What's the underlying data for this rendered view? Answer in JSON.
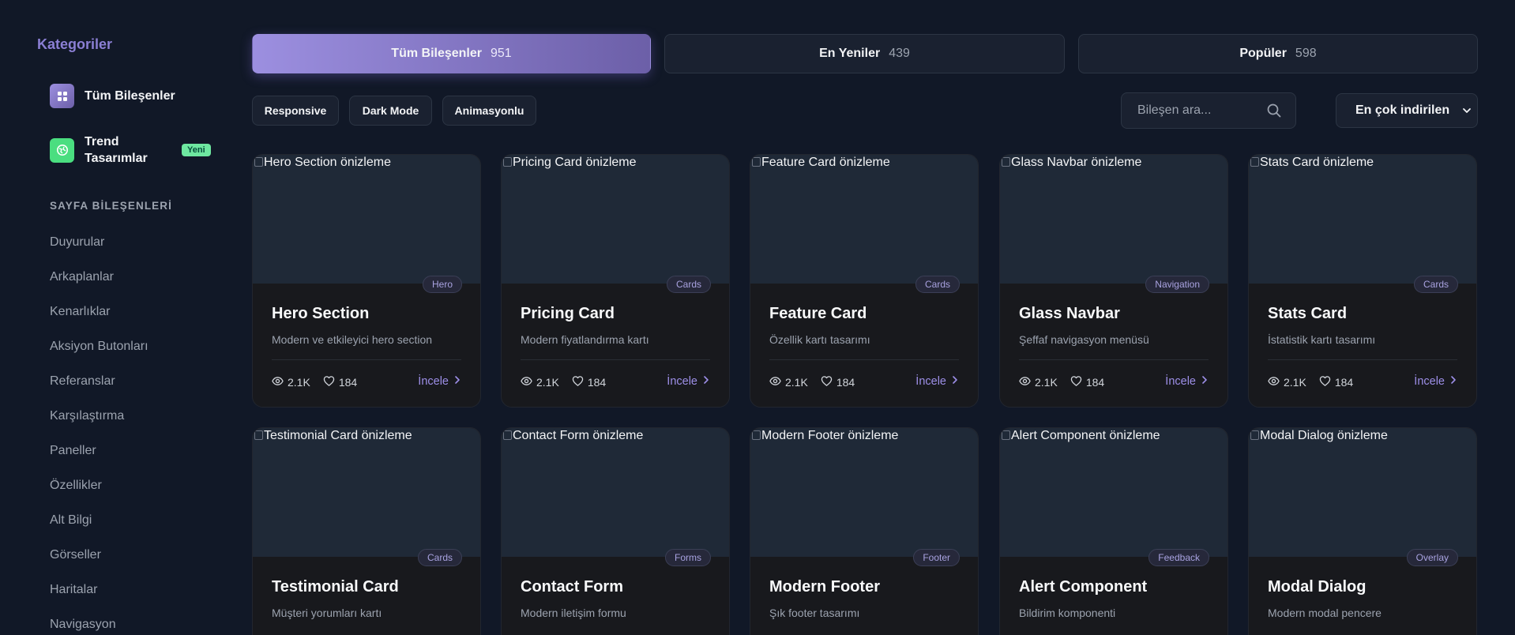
{
  "sidebar": {
    "title": "Kategoriler",
    "main_items": [
      {
        "label": "Tüm Bileşenler",
        "icon": "grid-icon"
      },
      {
        "label": "Trend Tasarımlar",
        "icon": "globe-icon",
        "badge": "Yeni"
      }
    ],
    "section_title": "SAYFA BİLEŞENLERİ",
    "links": [
      "Duyurular",
      "Arkaplanlar",
      "Kenarlıklar",
      "Aksiyon Butonları",
      "Referanslar",
      "Karşılaştırma",
      "Paneller",
      "Özellikler",
      "Alt Bilgi",
      "Görseller",
      "Haritalar",
      "Navigasyon"
    ]
  },
  "tabs": [
    {
      "label": "Tüm Bileşenler",
      "count": "951",
      "active": true
    },
    {
      "label": "En Yeniler",
      "count": "439",
      "active": false
    },
    {
      "label": "Popüler",
      "count": "598",
      "active": false
    }
  ],
  "filters": [
    "Responsive",
    "Dark Mode",
    "Animasyonlu"
  ],
  "search": {
    "placeholder": "Bileşen ara...",
    "value": ""
  },
  "sort": {
    "selected": "En çok indirilen"
  },
  "cards": [
    {
      "alt": "Hero Section önizleme",
      "category": "Hero",
      "title": "Hero Section",
      "desc": "Modern ve etkileyici hero section",
      "views": "2.1K",
      "likes": "184",
      "action": "İncele"
    },
    {
      "alt": "Pricing Card önizleme",
      "category": "Cards",
      "title": "Pricing Card",
      "desc": "Modern fiyatlandırma kartı",
      "views": "2.1K",
      "likes": "184",
      "action": "İncele"
    },
    {
      "alt": "Feature Card önizleme",
      "category": "Cards",
      "title": "Feature Card",
      "desc": "Özellik kartı tasarımı",
      "views": "2.1K",
      "likes": "184",
      "action": "İncele"
    },
    {
      "alt": "Glass Navbar önizleme",
      "category": "Navigation",
      "title": "Glass Navbar",
      "desc": "Şeffaf navigasyon menüsü",
      "views": "2.1K",
      "likes": "184",
      "action": "İncele"
    },
    {
      "alt": "Stats Card önizleme",
      "category": "Cards",
      "title": "Stats Card",
      "desc": "İstatistik kartı tasarımı",
      "views": "2.1K",
      "likes": "184",
      "action": "İncele"
    },
    {
      "alt": "Testimonial Card önizleme",
      "category": "Cards",
      "title": "Testimonial Card",
      "desc": "Müşteri yorumları kartı",
      "views": "",
      "likes": "",
      "action": ""
    },
    {
      "alt": "Contact Form önizleme",
      "category": "Forms",
      "title": "Contact Form",
      "desc": "Modern iletişim formu",
      "views": "",
      "likes": "",
      "action": ""
    },
    {
      "alt": "Modern Footer önizleme",
      "category": "Footer",
      "title": "Modern Footer",
      "desc": "Şık footer tasarımı",
      "views": "",
      "likes": "",
      "action": ""
    },
    {
      "alt": "Alert Component önizleme",
      "category": "Feedback",
      "title": "Alert Component",
      "desc": "Bildirim komponenti",
      "views": "",
      "likes": "",
      "action": ""
    },
    {
      "alt": "Modal Dialog önizleme",
      "category": "Overlay",
      "title": "Modal Dialog",
      "desc": "Modern modal pencere",
      "views": "",
      "likes": "",
      "action": ""
    }
  ],
  "colors": {
    "accent": "#8b7fd4",
    "background": "#111827",
    "card": "#18191d",
    "badge_new": "#6ee7a0"
  }
}
